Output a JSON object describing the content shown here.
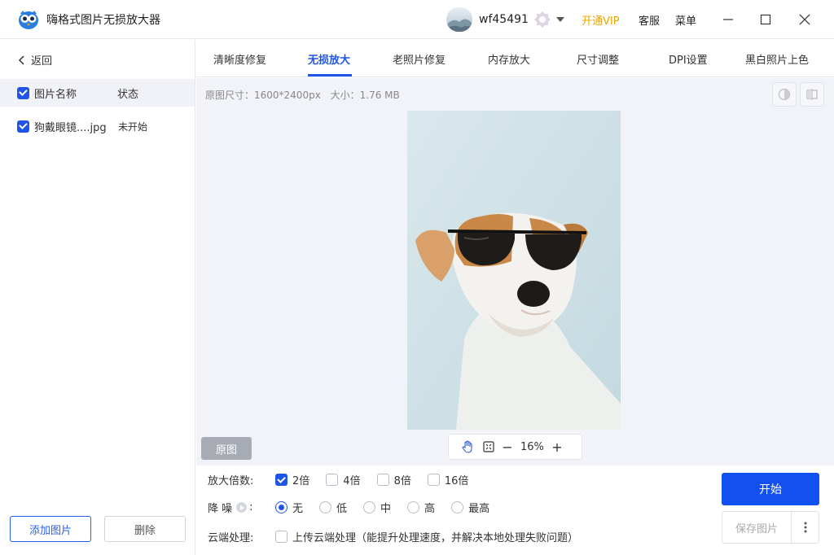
{
  "app": {
    "title": "嗨格式图片无损放大器"
  },
  "user": {
    "name": "wf45491",
    "vip_label": "开通VIP",
    "service_label": "客服",
    "menu_label": "菜单"
  },
  "sidebar": {
    "back_label": "返回",
    "header": {
      "name_col": "图片名称",
      "status_col": "状态"
    },
    "files": [
      {
        "name": "狗戴眼镜....jpg",
        "status": "未开始"
      }
    ],
    "add_label": "添加图片",
    "delete_label": "删除"
  },
  "tabs": [
    {
      "label": "清晰度修复"
    },
    {
      "label": "无损放大",
      "active": true
    },
    {
      "label": "老照片修复"
    },
    {
      "label": "内存放大"
    },
    {
      "label": "尺寸调整"
    },
    {
      "label": "DPI设置"
    },
    {
      "label": "黑白照片上色"
    }
  ],
  "preview": {
    "size_info": "原图尺寸：1600*2400px",
    "file_size": "大小：1.76 MB",
    "original_label": "原图",
    "zoom_value": "16%",
    "zoom_minus": "−",
    "zoom_plus": "+"
  },
  "options": {
    "scale": {
      "label": "放大倍数:",
      "choices": [
        "2倍",
        "4倍",
        "8倍",
        "16倍"
      ],
      "selected": "2倍"
    },
    "denoise": {
      "label": "降 噪",
      "colon": ":",
      "choices": [
        "无",
        "低",
        "中",
        "高",
        "最高"
      ],
      "selected": "无"
    },
    "cloud": {
      "label": "云端处理:",
      "option": "上传云端处理（能提升处理速度，并解决本地处理失败问题）"
    }
  },
  "actions": {
    "start_label": "开始",
    "save_label": "保存图片"
  },
  "colors": {
    "accent": "#1f55e6",
    "vip": "#f0a500",
    "start": "#1250f0"
  }
}
